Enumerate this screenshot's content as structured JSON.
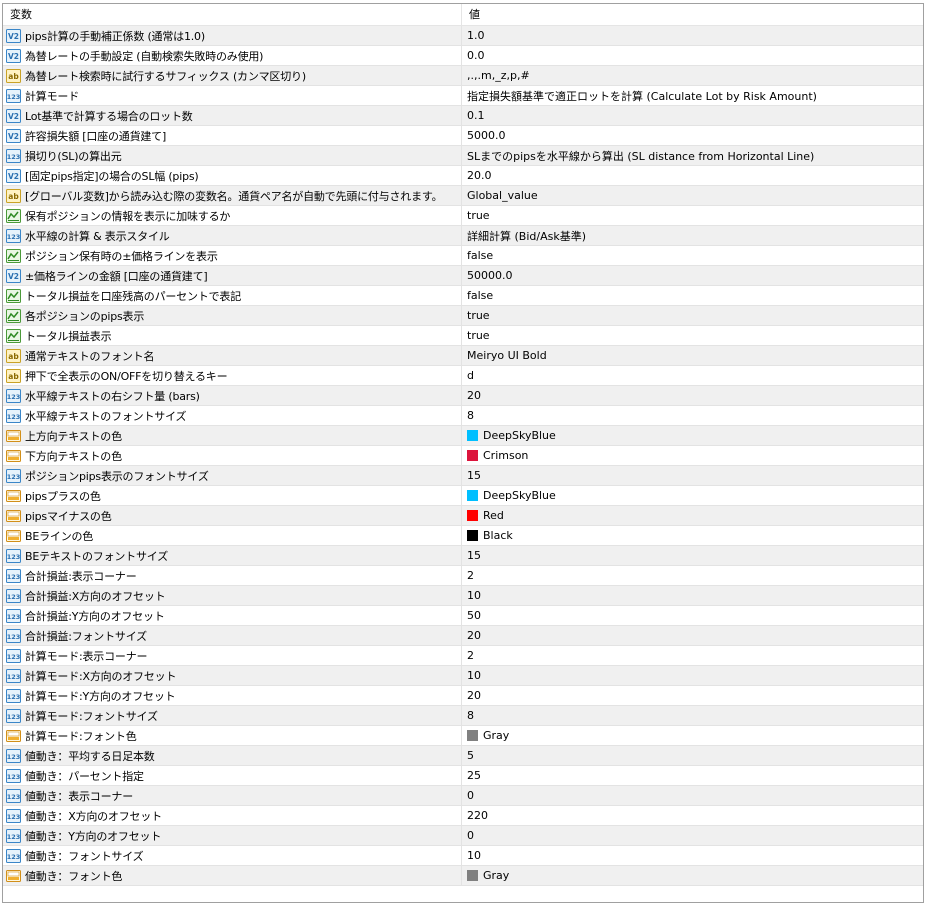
{
  "header": {
    "name_col": "変数",
    "value_col": "値"
  },
  "rows": [
    {
      "icon": "double-icon",
      "name": "pips計算の手動補正係数 (通常は1.0)",
      "value": "1.0"
    },
    {
      "icon": "double-icon",
      "name": "為替レートの手動設定 (自動検索失敗時のみ使用)",
      "value": "0.0"
    },
    {
      "icon": "string-icon",
      "name": "為替レート検索時に試行するサフィックス (カンマ区切り)",
      "value": ",.,.m,_z,p,#"
    },
    {
      "icon": "int-icon",
      "name": "計算モード",
      "value": "指定損失額基準で適正ロットを計算 (Calculate Lot by Risk Amount)"
    },
    {
      "icon": "double-icon",
      "name": "Lot基準で計算する場合のロット数",
      "value": "0.1"
    },
    {
      "icon": "double-icon",
      "name": "許容損失額 [口座の通貨建て]",
      "value": "5000.0"
    },
    {
      "icon": "int-icon",
      "name": "損切り(SL)の算出元",
      "value": "SLまでのpipsを水平線から算出 (SL distance from Horizontal Line)"
    },
    {
      "icon": "double-icon",
      "name": "[固定pips指定]の場合のSL幅 (pips)",
      "value": "20.0"
    },
    {
      "icon": "string-icon",
      "name": "[グローバル変数]から読み込む際の変数名。通貨ペア名が自動で先頭に付与されます。",
      "value": "Global_value"
    },
    {
      "icon": "bool-icon",
      "name": "保有ポジションの情報を表示に加味するか",
      "value": "true"
    },
    {
      "icon": "int-icon",
      "name": "水平線の計算 & 表示スタイル",
      "value": "詳細計算 (Bid/Ask基準)"
    },
    {
      "icon": "bool-icon",
      "name": "ポジション保有時の±価格ラインを表示",
      "value": "false"
    },
    {
      "icon": "double-icon",
      "name": "±価格ラインの金額 [口座の通貨建て]",
      "value": "50000.0"
    },
    {
      "icon": "bool-icon",
      "name": "トータル損益を口座残高のパーセントで表記",
      "value": "false"
    },
    {
      "icon": "bool-icon",
      "name": "各ポジションのpips表示",
      "value": "true"
    },
    {
      "icon": "bool-icon",
      "name": "トータル損益表示",
      "value": "true"
    },
    {
      "icon": "string-icon",
      "name": "通常テキストのフォント名",
      "value": "Meiryo UI Bold"
    },
    {
      "icon": "string-icon",
      "name": "押下で全表示のON/OFFを切り替えるキー",
      "value": "d"
    },
    {
      "icon": "int-icon",
      "name": "水平線テキストの右シフト量 (bars)",
      "value": "20"
    },
    {
      "icon": "int-icon",
      "name": "水平線テキストのフォントサイズ",
      "value": "8"
    },
    {
      "icon": "color-icon",
      "name": "上方向テキストの色",
      "value": "DeepSkyBlue",
      "swatch": "#00bfff"
    },
    {
      "icon": "color-icon",
      "name": "下方向テキストの色",
      "value": "Crimson",
      "swatch": "#dc143c"
    },
    {
      "icon": "int-icon",
      "name": "ポジションpips表示のフォントサイズ",
      "value": "15"
    },
    {
      "icon": "color-icon",
      "name": "pipsプラスの色",
      "value": "DeepSkyBlue",
      "swatch": "#00bfff"
    },
    {
      "icon": "color-icon",
      "name": "pipsマイナスの色",
      "value": "Red",
      "swatch": "#ff0000"
    },
    {
      "icon": "color-icon",
      "name": "BEラインの色",
      "value": "Black",
      "swatch": "#000000"
    },
    {
      "icon": "int-icon",
      "name": "BEテキストのフォントサイズ",
      "value": "15"
    },
    {
      "icon": "int-icon",
      "name": "合計損益:表示コーナー",
      "value": "2"
    },
    {
      "icon": "int-icon",
      "name": "合計損益:X方向のオフセット",
      "value": "10"
    },
    {
      "icon": "int-icon",
      "name": "合計損益:Y方向のオフセット",
      "value": "50"
    },
    {
      "icon": "int-icon",
      "name": "合計損益:フォントサイズ",
      "value": "20"
    },
    {
      "icon": "int-icon",
      "name": "計算モード:表示コーナー",
      "value": "2"
    },
    {
      "icon": "int-icon",
      "name": "計算モード:X方向のオフセット",
      "value": "10"
    },
    {
      "icon": "int-icon",
      "name": "計算モード:Y方向のオフセット",
      "value": "20"
    },
    {
      "icon": "int-icon",
      "name": "計算モード:フォントサイズ",
      "value": "8"
    },
    {
      "icon": "color-icon",
      "name": "計算モード:フォント色",
      "value": "Gray",
      "swatch": "#808080"
    },
    {
      "icon": "int-icon",
      "name": "値動き：平均する日足本数",
      "value": "5"
    },
    {
      "icon": "int-icon",
      "name": "値動き：パーセント指定",
      "value": "25"
    },
    {
      "icon": "int-icon",
      "name": "値動き：表示コーナー",
      "value": "0"
    },
    {
      "icon": "int-icon",
      "name": "値動き：X方向のオフセット",
      "value": "220"
    },
    {
      "icon": "int-icon",
      "name": "値動き：Y方向のオフセット",
      "value": "0"
    },
    {
      "icon": "int-icon",
      "name": "値動き：フォントサイズ",
      "value": "10"
    },
    {
      "icon": "color-icon",
      "name": "値動き：フォント色",
      "value": "Gray",
      "swatch": "#808080"
    }
  ]
}
